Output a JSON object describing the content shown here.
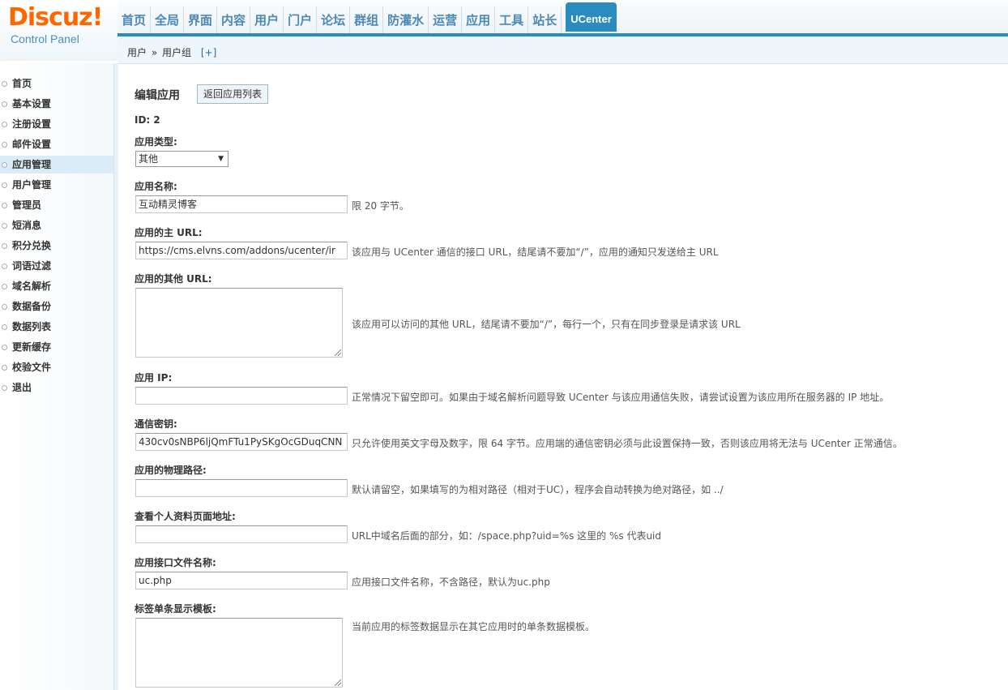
{
  "logo": {
    "brand": "Discuz!",
    "subtitle": "Control Panel"
  },
  "nav": {
    "items": [
      "首页",
      "全局",
      "界面",
      "内容",
      "用户",
      "门户",
      "论坛",
      "群组",
      "防灌水",
      "运营",
      "应用",
      "工具",
      "站长"
    ],
    "active": "UCenter"
  },
  "breadcrumb": {
    "part1": "用户",
    "sep": "»",
    "part2": "用户组",
    "add": "[+]"
  },
  "sidebar": {
    "items": [
      "首页",
      "基本设置",
      "注册设置",
      "邮件设置",
      "应用管理",
      "用户管理",
      "管理员",
      "短消息",
      "积分兑换",
      "词语过滤",
      "域名解析",
      "数据备份",
      "数据列表",
      "更新缓存",
      "校验文件",
      "退出"
    ],
    "active_index": 4
  },
  "form": {
    "title": "编辑应用",
    "back_button": "返回应用列表",
    "id_line": "ID: 2",
    "type_label": "应用类型:",
    "type_value": "其他",
    "name_label": "应用名称:",
    "name_value": "互动精灵博客",
    "name_hint": "限 20 字节。",
    "url_label": "应用的主 URL:",
    "url_value": "https://cms.elvns.com/addons/ucenter/ir",
    "url_hint": "该应用与 UCenter 通信的接口 URL，结尾请不要加“/”，应用的通知只发送给主 URL",
    "other_url_label": "应用的其他 URL:",
    "other_url_hint": "该应用可以访问的其他 URL，结尾请不要加“/”，每行一个，只有在同步登录是请求该 URL",
    "ip_label": "应用 IP:",
    "ip_hint": "正常情况下留空即可。如果由于域名解析问题导致 UCenter 与该应用通信失败，请尝试设置为该应用所在服务器的 IP 地址。",
    "key_label": "通信密钥:",
    "key_value": "430cv0sNBP6ljQmFTu1PySKgOcGDuqCNN",
    "key_hint": "只允许使用英文字母及数字，限 64 字节。应用端的通信密钥必须与此设置保持一致，否则该应用将无法与 UCenter 正常通信。",
    "path_label": "应用的物理路径:",
    "path_hint": "默认请留空，如果填写的为相对路径（相对于UC），程序会自动转换为绝对路径，如 ../",
    "profile_label": "查看个人资料页面地址:",
    "profile_hint": "URL中域名后面的部分，如：/space.php?uid=%s 这里的 %s 代表uid",
    "api_label": "应用接口文件名称:",
    "api_value": "uc.php",
    "api_hint": "应用接口文件名称，不含路径，默认为uc.php",
    "tpl_label": "标签单条显示模板:",
    "tpl_hint": "当前应用的标签数据显示在其它应用时的单条数据模板。"
  }
}
